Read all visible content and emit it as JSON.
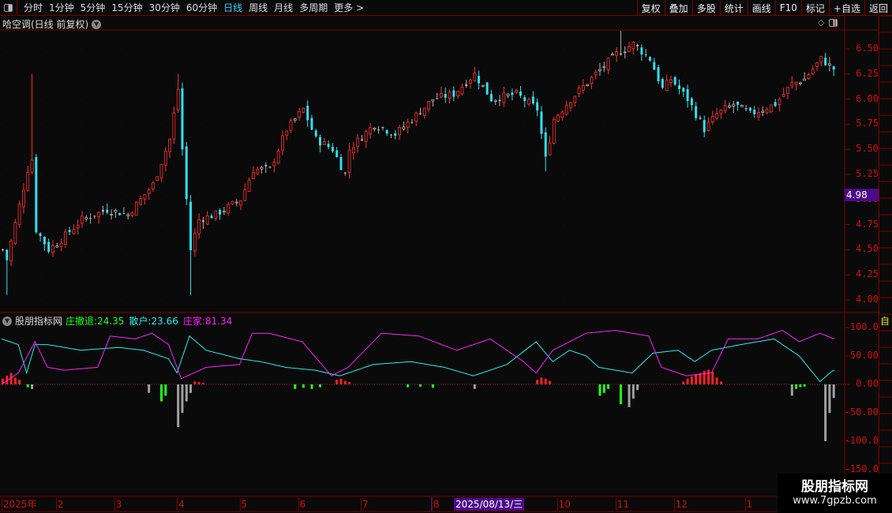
{
  "toolbar": {
    "periods": [
      "分时",
      "1分钟",
      "5分钟",
      "15分钟",
      "30分钟",
      "60分钟",
      "日线",
      "周线",
      "月线",
      "多周期",
      "更多 >"
    ],
    "active": "日线",
    "right_buttons": [
      "复权",
      "叠加",
      "多股",
      "统计",
      "画线",
      "F10",
      "标记",
      "+自选",
      "返回"
    ]
  },
  "main_chart": {
    "title": "哈空调(日线 前复权)",
    "price_axis": [
      "6.50",
      "6.25",
      "6.00",
      "5.75",
      "5.50",
      "5.25",
      "5.00",
      "4.75",
      "4.50",
      "4.25",
      "4.00"
    ],
    "current_price": "4.98",
    "colors": {
      "up": "#ff3030",
      "down": "#30e0f0",
      "flat": "#b0b0b0"
    },
    "close_keys": [
      [
        0,
        4.5
      ],
      [
        1,
        4.4
      ],
      [
        6,
        5.3
      ],
      [
        7,
        5.4
      ],
      [
        8,
        4.7
      ],
      [
        11,
        4.5
      ],
      [
        14,
        4.6
      ],
      [
        19,
        4.8
      ],
      [
        25,
        4.9
      ],
      [
        30,
        4.85
      ],
      [
        36,
        5.15
      ],
      [
        40,
        5.6
      ],
      [
        42,
        6.1
      ],
      [
        43,
        5.5
      ],
      [
        45,
        4.5
      ],
      [
        47,
        4.8
      ],
      [
        51,
        4.85
      ],
      [
        57,
        5.0
      ],
      [
        60,
        5.3
      ],
      [
        64,
        5.3
      ],
      [
        68,
        5.7
      ],
      [
        72,
        5.9
      ],
      [
        75,
        5.6
      ],
      [
        79,
        5.5
      ],
      [
        82,
        5.25
      ],
      [
        83,
        5.5
      ],
      [
        89,
        5.75
      ],
      [
        94,
        5.65
      ],
      [
        98,
        5.8
      ],
      [
        103,
        6.0
      ],
      [
        108,
        6.05
      ],
      [
        113,
        6.25
      ],
      [
        117,
        6.0
      ],
      [
        123,
        6.05
      ],
      [
        128,
        5.9
      ],
      [
        130,
        5.4
      ],
      [
        132,
        5.8
      ],
      [
        136,
        6.0
      ],
      [
        142,
        6.25
      ],
      [
        147,
        6.45
      ],
      [
        151,
        6.55
      ],
      [
        155,
        6.4
      ],
      [
        158,
        6.1
      ],
      [
        160,
        6.2
      ],
      [
        164,
        6.0
      ],
      [
        168,
        5.7
      ],
      [
        171,
        5.85
      ],
      [
        175,
        5.95
      ],
      [
        179,
        5.85
      ],
      [
        185,
        5.95
      ],
      [
        189,
        6.15
      ],
      [
        192,
        6.2
      ],
      [
        196,
        6.4
      ],
      [
        199,
        6.3
      ]
    ],
    "extremes": [
      [
        7,
        6.25,
        "high"
      ],
      [
        42,
        6.25,
        "high"
      ],
      [
        45,
        4.05,
        "low"
      ],
      [
        1,
        4.05,
        "low"
      ],
      [
        130,
        5.28,
        "low"
      ],
      [
        148,
        6.68,
        "high"
      ]
    ],
    "days": 200
  },
  "indicator": {
    "name": "股朋指标网",
    "series": [
      {
        "label": "庄撤退",
        "value": "24.35",
        "color": "#20ff20"
      },
      {
        "label": "散户",
        "value": "23.66",
        "color": "#20f0f0"
      },
      {
        "label": "庄家",
        "value": "81.34",
        "color": "#ff20ff"
      }
    ],
    "axis": [
      "100.0",
      "50.00",
      "0.00",
      "-50.00",
      "-100.0",
      "-150.0"
    ],
    "retail_keys": [
      [
        0,
        80
      ],
      [
        4,
        70
      ],
      [
        6,
        20
      ],
      [
        8,
        70
      ],
      [
        11,
        70
      ],
      [
        19,
        60
      ],
      [
        28,
        65
      ],
      [
        34,
        60
      ],
      [
        40,
        45
      ],
      [
        42,
        20
      ],
      [
        45,
        85
      ],
      [
        49,
        60
      ],
      [
        57,
        45
      ],
      [
        62,
        40
      ],
      [
        68,
        30
      ],
      [
        75,
        25
      ],
      [
        81,
        15
      ],
      [
        89,
        35
      ],
      [
        98,
        40
      ],
      [
        106,
        30
      ],
      [
        113,
        15
      ],
      [
        121,
        35
      ],
      [
        128,
        75
      ],
      [
        132,
        40
      ],
      [
        136,
        60
      ],
      [
        140,
        50
      ],
      [
        143,
        30
      ],
      [
        151,
        20
      ],
      [
        156,
        55
      ],
      [
        162,
        60
      ],
      [
        166,
        40
      ],
      [
        170,
        60
      ],
      [
        177,
        70
      ],
      [
        185,
        80
      ],
      [
        191,
        50
      ],
      [
        196,
        5
      ],
      [
        199,
        24
      ]
    ],
    "banker_keys": [
      [
        0,
        0
      ],
      [
        4,
        20
      ],
      [
        8,
        75
      ],
      [
        11,
        30
      ],
      [
        15,
        25
      ],
      [
        23,
        30
      ],
      [
        26,
        85
      ],
      [
        32,
        80
      ],
      [
        36,
        90
      ],
      [
        40,
        70
      ],
      [
        43,
        10
      ],
      [
        49,
        30
      ],
      [
        57,
        35
      ],
      [
        60,
        90
      ],
      [
        64,
        90
      ],
      [
        72,
        75
      ],
      [
        79,
        15
      ],
      [
        83,
        30
      ],
      [
        91,
        90
      ],
      [
        100,
        85
      ],
      [
        109,
        60
      ],
      [
        117,
        80
      ],
      [
        125,
        40
      ],
      [
        128,
        20
      ],
      [
        132,
        60
      ],
      [
        140,
        90
      ],
      [
        147,
        95
      ],
      [
        155,
        85
      ],
      [
        158,
        30
      ],
      [
        164,
        15
      ],
      [
        170,
        20
      ],
      [
        174,
        80
      ],
      [
        181,
        80
      ],
      [
        187,
        95
      ],
      [
        191,
        75
      ],
      [
        196,
        90
      ],
      [
        199,
        81
      ]
    ],
    "bars": [
      [
        0,
        10,
        "r"
      ],
      [
        1,
        15,
        "r"
      ],
      [
        2,
        20,
        "r"
      ],
      [
        3,
        12,
        "r"
      ],
      [
        4,
        8,
        "r"
      ],
      [
        6,
        -5,
        "g"
      ],
      [
        7,
        -8,
        "n"
      ],
      [
        35,
        -15,
        "n"
      ],
      [
        38,
        -30,
        "g"
      ],
      [
        39,
        -20,
        "g"
      ],
      [
        42,
        -75,
        "n"
      ],
      [
        43,
        -50,
        "n"
      ],
      [
        44,
        -30,
        "n"
      ],
      [
        45,
        -15,
        "n"
      ],
      [
        46,
        5,
        "r"
      ],
      [
        47,
        4,
        "r"
      ],
      [
        48,
        3,
        "r"
      ],
      [
        70,
        -8,
        "g"
      ],
      [
        72,
        -6,
        "g"
      ],
      [
        74,
        -8,
        "g"
      ],
      [
        76,
        -5,
        "g"
      ],
      [
        80,
        8,
        "r"
      ],
      [
        81,
        10,
        "r"
      ],
      [
        82,
        6,
        "r"
      ],
      [
        83,
        4,
        "r"
      ],
      [
        97,
        -5,
        "g"
      ],
      [
        100,
        -4,
        "g"
      ],
      [
        103,
        -6,
        "g"
      ],
      [
        113,
        -8,
        "n"
      ],
      [
        128,
        8,
        "r"
      ],
      [
        129,
        12,
        "r"
      ],
      [
        130,
        10,
        "r"
      ],
      [
        131,
        6,
        "r"
      ],
      [
        143,
        -20,
        "g"
      ],
      [
        144,
        -15,
        "g"
      ],
      [
        145,
        -8,
        "g"
      ],
      [
        148,
        -35,
        "g"
      ],
      [
        150,
        -40,
        "n"
      ],
      [
        151,
        -25,
        "n"
      ],
      [
        152,
        -10,
        "n"
      ],
      [
        163,
        5,
        "r"
      ],
      [
        164,
        10,
        "r"
      ],
      [
        165,
        14,
        "r"
      ],
      [
        166,
        18,
        "r"
      ],
      [
        167,
        20,
        "r"
      ],
      [
        168,
        24,
        "r"
      ],
      [
        169,
        26,
        "r"
      ],
      [
        170,
        22,
        "r"
      ],
      [
        171,
        12,
        "r"
      ],
      [
        172,
        5,
        "r"
      ],
      [
        189,
        -20,
        "n"
      ],
      [
        190,
        -8,
        "g"
      ],
      [
        191,
        -5,
        "g"
      ],
      [
        192,
        -4,
        "g"
      ],
      [
        197,
        -100,
        "n"
      ],
      [
        198,
        -50,
        "n"
      ],
      [
        199,
        -24,
        "n"
      ]
    ]
  },
  "time_axis": {
    "labels": [
      "2025年",
      "2",
      "3",
      "4",
      "5",
      "6",
      "7",
      "8",
      "10",
      "11",
      "12",
      "1"
    ],
    "label_days": [
      0,
      13,
      27,
      42,
      57,
      71,
      86,
      103,
      133,
      147,
      161,
      178
    ],
    "crosshair_date": "2025/08/13/三"
  },
  "side": {
    "tag": "自"
  },
  "watermark": {
    "line1": "股朋指标网",
    "line2": "www.7gpzb.com"
  }
}
